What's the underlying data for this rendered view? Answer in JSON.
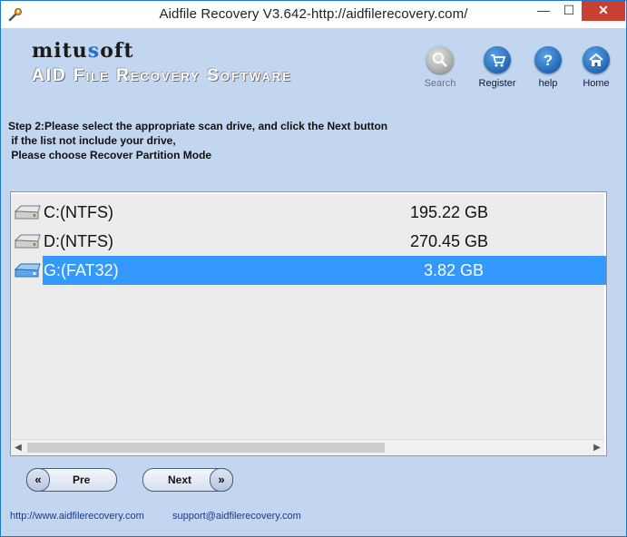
{
  "window": {
    "title": "Aidfile Recovery V3.642-http://aidfilerecovery.com/",
    "minimize_glyph": "—",
    "maximize_glyph": "☐",
    "close_glyph": "✕"
  },
  "logo": {
    "brand_pre": "mitu",
    "brand_o": "s",
    "brand_post": "oft",
    "subtitle": "AID File Recovery Software"
  },
  "toolbar": {
    "search_label": "Search",
    "register_label": "Register",
    "help_label": "help",
    "home_label": "Home"
  },
  "instructions": {
    "line1": "Step 2:Please select the appropriate scan drive, and click the Next button",
    "line2": " if the list not include your drive,",
    "line3": " Please choose Recover Partition Mode"
  },
  "drives": [
    {
      "name": "C:(NTFS)",
      "size": "195.22 GB",
      "selected": false
    },
    {
      "name": "D:(NTFS)",
      "size": "270.45 GB",
      "selected": false
    },
    {
      "name": "G:(FAT32)",
      "size": "3.82 GB",
      "selected": true
    }
  ],
  "buttons": {
    "pre_label": "Pre",
    "next_label": "Next",
    "pre_cap": "«",
    "next_cap": "»"
  },
  "footer": {
    "website": "http://www.aidfilerecovery.com",
    "email": "support@aidfilerecovery.com"
  },
  "colors": {
    "background": "#c3d6ef",
    "selection": "#3399ff",
    "close": "#c84031"
  }
}
